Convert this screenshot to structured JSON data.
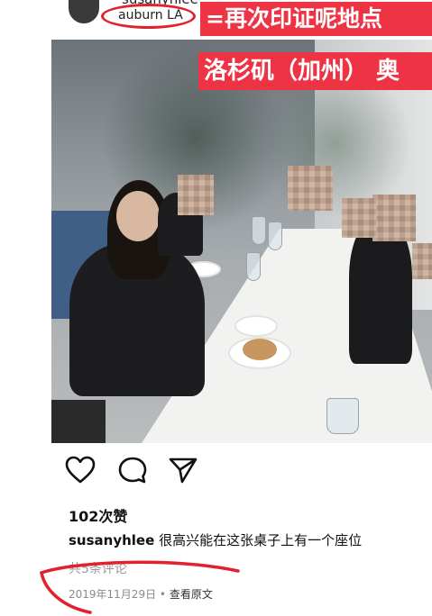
{
  "header": {
    "username_partial": "susanyhlee",
    "location": "auburn LA"
  },
  "annotations": {
    "top": "=再次印证呢地点",
    "mid": "洛杉矶（加州） 奥"
  },
  "post": {
    "likes": "102次赞",
    "caption_user": "susanyhlee",
    "caption_text": "很高兴能在这张桌子上有一个座位",
    "comments": "共5条评论",
    "date": "2019年11月29日",
    "separator": "•",
    "view_original": "查看原文"
  },
  "icons": {
    "like": "heart-icon",
    "comment": "comment-bubble-icon",
    "share": "paper-plane-icon"
  },
  "colors": {
    "annotation_bg": "#ee3344",
    "annotation_stroke": "#e0222f"
  }
}
